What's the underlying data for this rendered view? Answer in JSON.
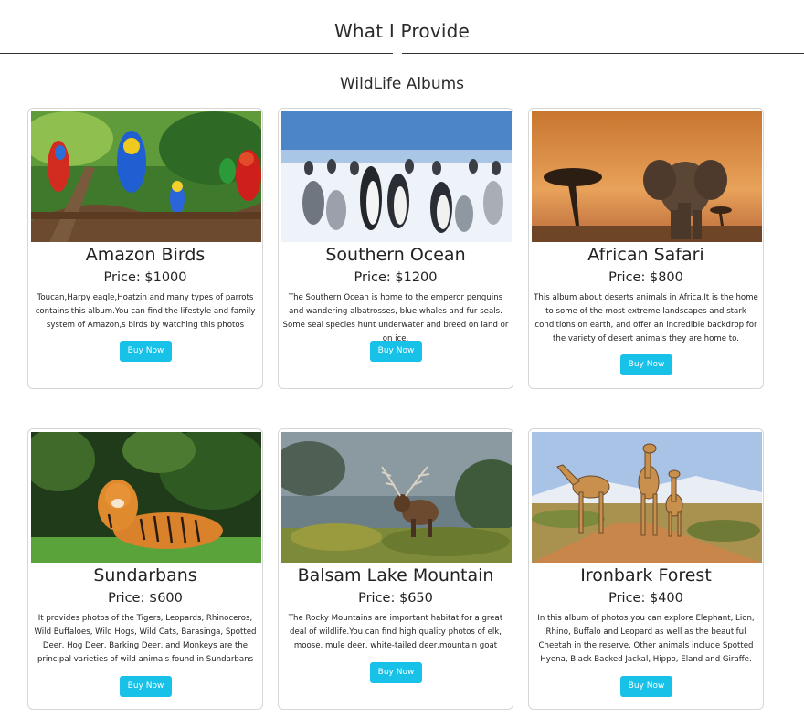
{
  "header": {
    "title": "What I Provide",
    "subtitle": "WildLife Albums"
  },
  "albums": [
    {
      "title": "Amazon Birds",
      "price": "Price: $1000",
      "description": "Toucan,Harpy eagle,Hoatzin and many types of parrots contains this album.You can find the lifestyle and family system of Amazon,s birds by watching this photos",
      "button": "Buy Now",
      "image": "parrots-photo"
    },
    {
      "title": "Southern Ocean",
      "price": "Price: $1200",
      "description": "The Southern Ocean is home to the emperor penguins and wandering albatrosses, blue whales and fur seals. Some seal species hunt underwater and breed on land or on ice.",
      "button": "Buy Now",
      "image": "penguins-photo"
    },
    {
      "title": "African Safari",
      "price": "Price: $800",
      "description": "This album about deserts animals in Africa.It is the home to some of the most extreme landscapes and stark conditions on earth, and offer an incredible backdrop for the variety of desert animals they are home to.",
      "button": "Buy Now",
      "image": "elephant-sunset-photo"
    },
    {
      "title": "Sundarbans",
      "price": "Price: $600",
      "description": "It provides photos of the Tigers, Leopards, Rhinoceros, Wild Buffaloes, Wild Hogs, Wild Cats, Barasinga, Spotted Deer, Hog Deer, Barking Deer, and Monkeys are the principal varieties of wild animals found in Sundarbans",
      "button": "Buy Now",
      "image": "tiger-photo"
    },
    {
      "title": "Balsam Lake Mountain",
      "price": "Price: $650",
      "description": "The Rocky Mountains are important habitat for a great deal of wildlife.You can find high quality photos of elk, moose, mule deer, white-tailed deer,mountain goat",
      "button": "Buy Now",
      "image": "elk-photo"
    },
    {
      "title": "Ironbark Forest",
      "price": "Price: $400",
      "description": "In this album of photos you can explore Elephant, Lion, Rhino, Buffalo and Leopard as well as the beautiful Cheetah in the reserve. Other animals include Spotted Hyena, Black Backed Jackal, Hippo, Eland and Giraffe.",
      "button": "Buy Now",
      "image": "giraffes-photo"
    }
  ],
  "colors": {
    "button": "#17c1e8",
    "border": "#d6d6d6"
  }
}
